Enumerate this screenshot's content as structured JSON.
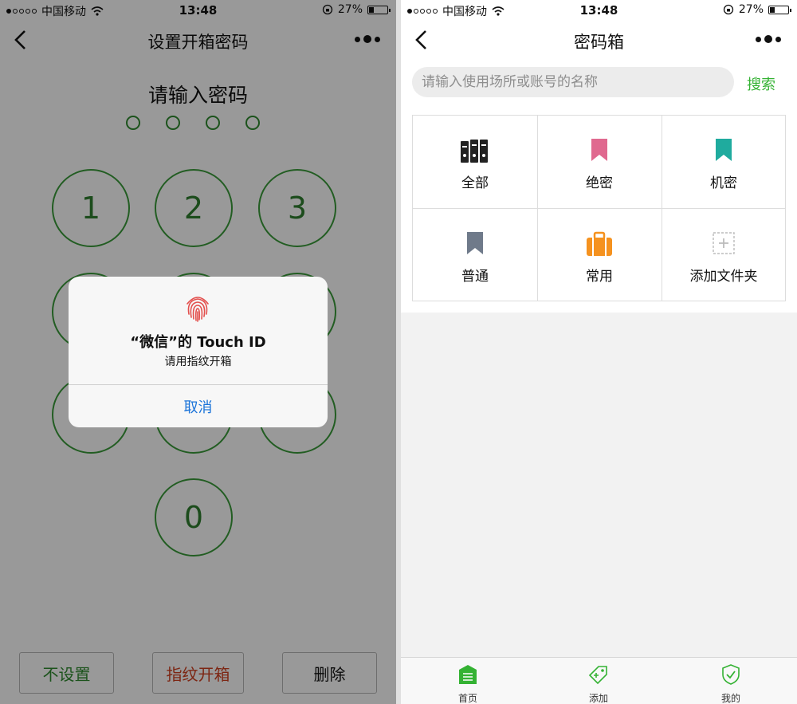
{
  "status": {
    "carrier": "中国移动",
    "time": "13:48",
    "battery": "27%",
    "battery_level": 0.27
  },
  "left": {
    "nav_title": "设置开箱密码",
    "prompt": "请输入密码",
    "keys": {
      "k1": "1",
      "k2": "2",
      "k3": "3",
      "k0": "0"
    },
    "buttons": {
      "no_set": "不设置",
      "fingerprint": "指纹开箱",
      "delete": "删除"
    },
    "dialog": {
      "title": "“微信”的 Touch ID",
      "message": "请用指纹开箱",
      "cancel": "取消"
    }
  },
  "right": {
    "nav_title": "密码箱",
    "search": {
      "placeholder": "请输入使用场所或账号的名称",
      "button": "搜索"
    },
    "categories": [
      {
        "label": "全部",
        "icon": "binders-icon"
      },
      {
        "label": "绝密",
        "icon": "bookmark-pink-icon",
        "color": "#e0698f"
      },
      {
        "label": "机密",
        "icon": "bookmark-teal-icon",
        "color": "#1fab9e"
      },
      {
        "label": "普通",
        "icon": "bookmark-gray-icon",
        "color": "#6f7a8a"
      },
      {
        "label": "常用",
        "icon": "briefcase-icon",
        "color": "#f5921f"
      },
      {
        "label": "添加文件夹",
        "icon": "add-folder-icon"
      }
    ],
    "tabs": [
      {
        "label": "首页",
        "icon": "home-icon",
        "active": true
      },
      {
        "label": "添加",
        "icon": "add-tag-icon"
      },
      {
        "label": "我的",
        "icon": "shield-check-icon"
      }
    ],
    "accent": "#34b233"
  }
}
